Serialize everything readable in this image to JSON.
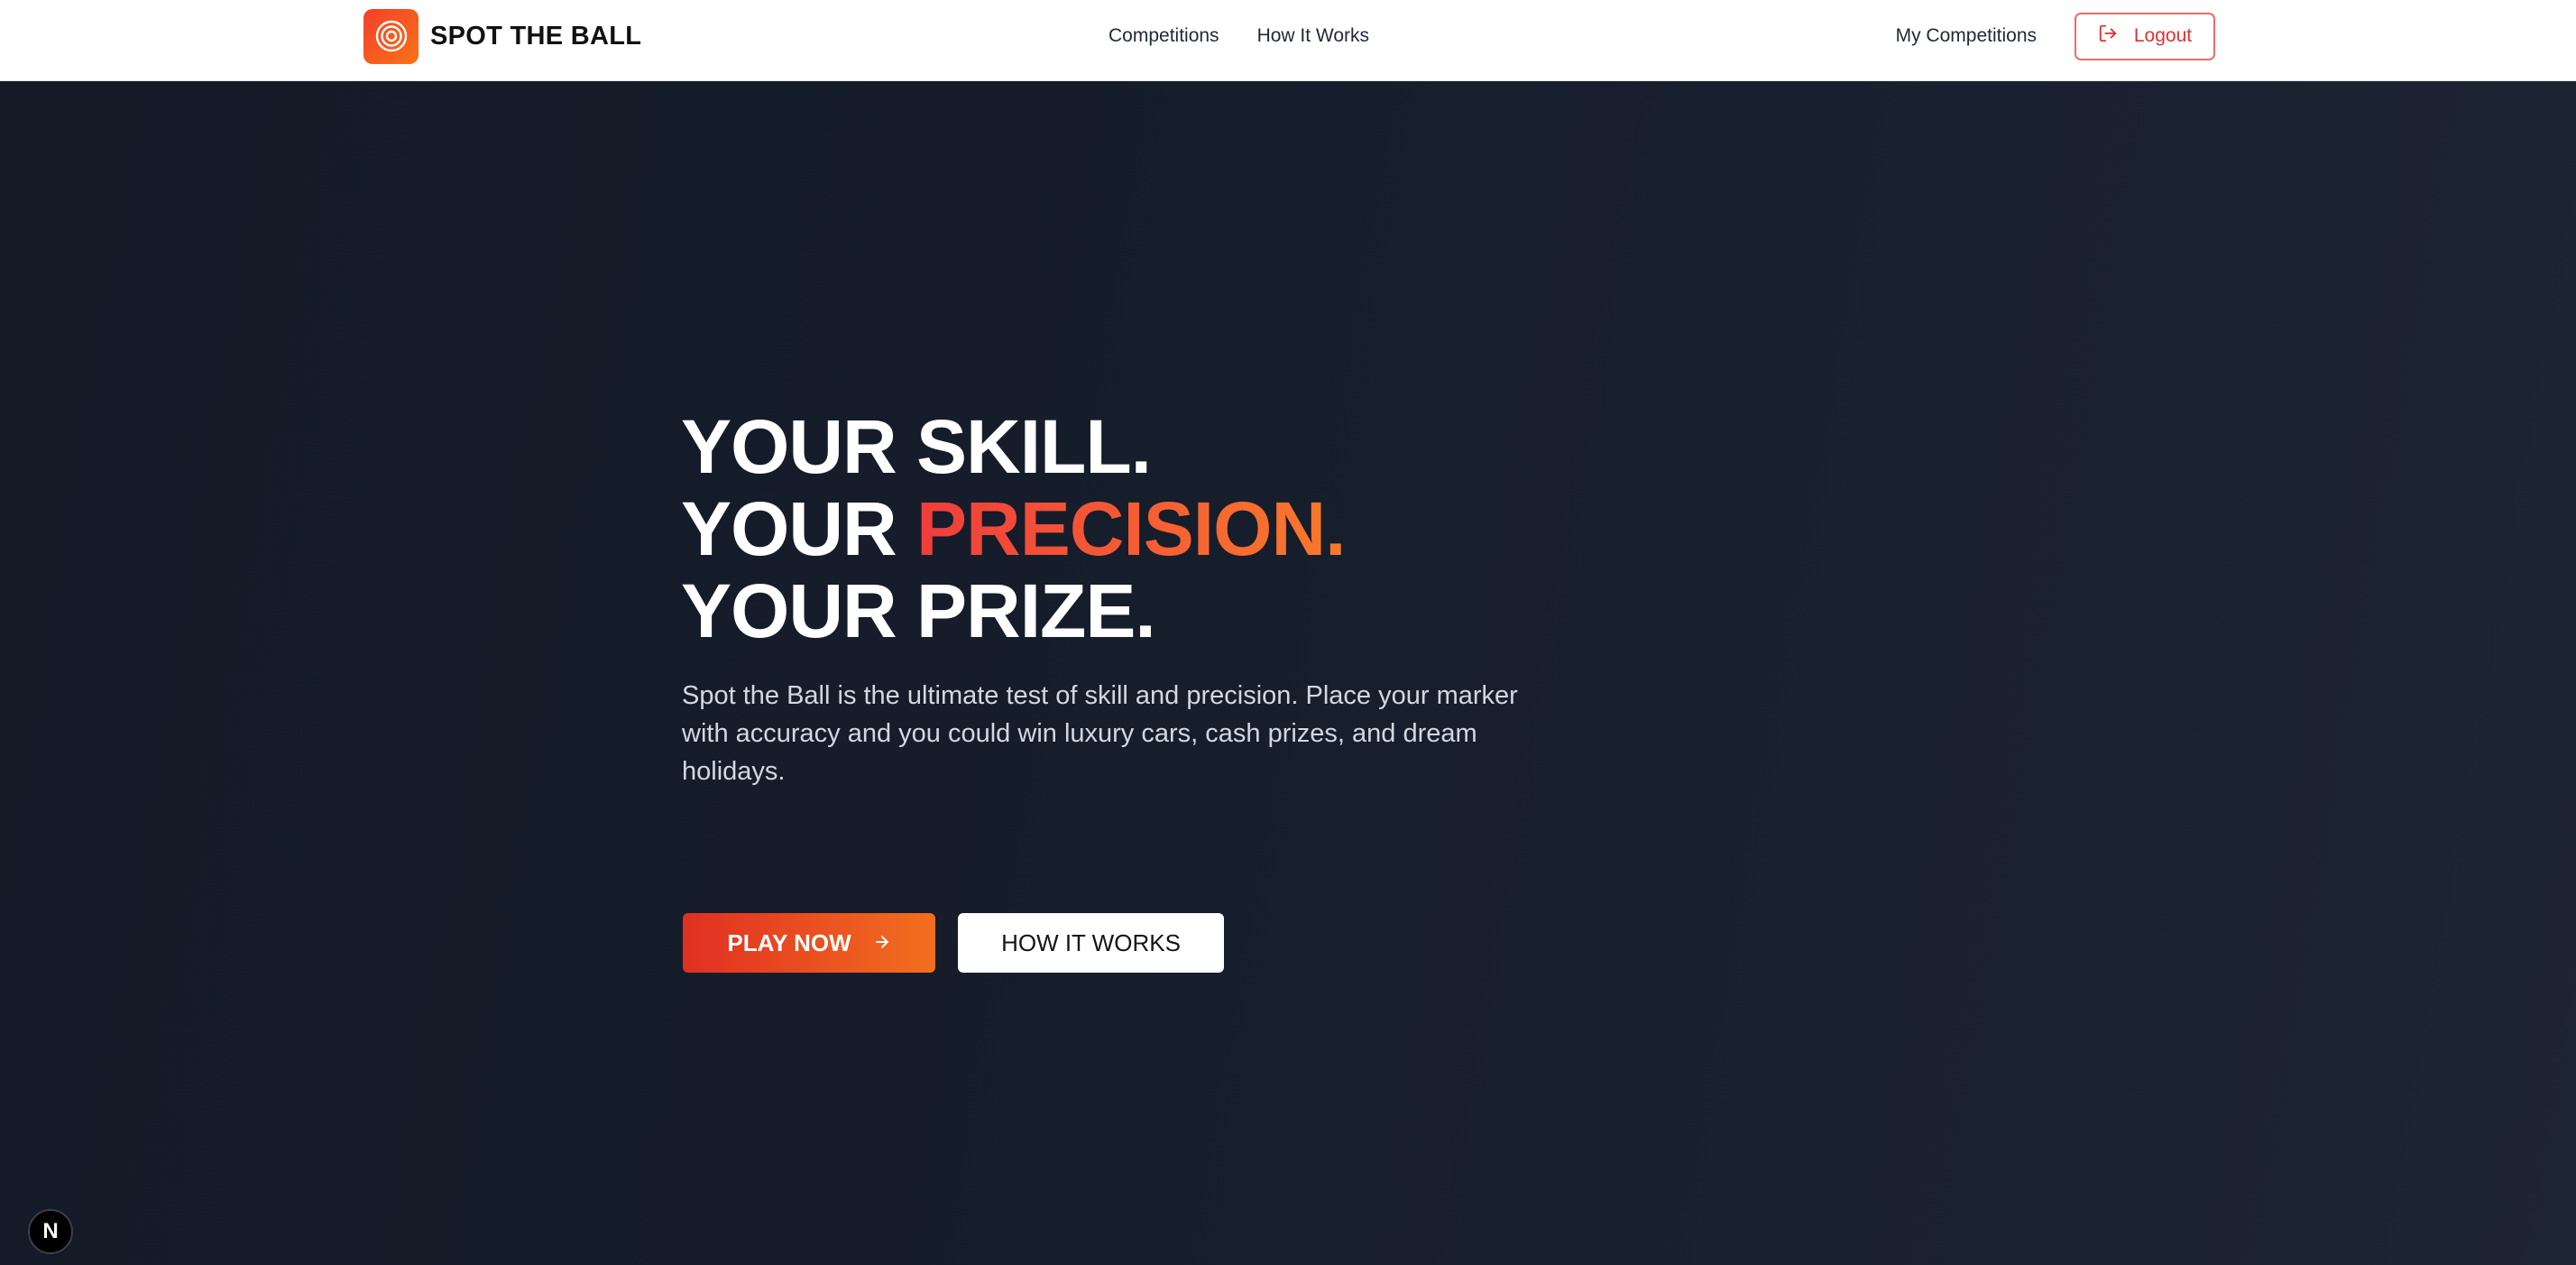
{
  "brand": {
    "name": "SPOT THE BALL",
    "logo_icon": "target-icon",
    "accent": "#f43f2b"
  },
  "nav": {
    "links": [
      {
        "label": "Competitions"
      },
      {
        "label": "How It Works"
      }
    ],
    "my_competitions": "My Competitions",
    "logout_label": "Logout",
    "logout_icon": "logout-icon"
  },
  "hero": {
    "line1": "YOUR SKILL.",
    "line2_prefix": "YOUR ",
    "line2_accent": "PRECISION.",
    "line3": "YOUR PRIZE.",
    "description": "Spot the Ball is the ultimate test of skill and precision. Place your marker with accuracy and you could win luxury cars, cash prizes, and dream holidays.",
    "play_label": "PLAY NOW",
    "play_icon": "arrow-right-icon",
    "how_label": "HOW IT WORKS"
  },
  "dev_badge": {
    "label": "N"
  },
  "colors": {
    "background": "#151b27",
    "accent_start": "#e02f22",
    "accent_end": "#f26f1e",
    "logout_text": "#e0312f"
  }
}
